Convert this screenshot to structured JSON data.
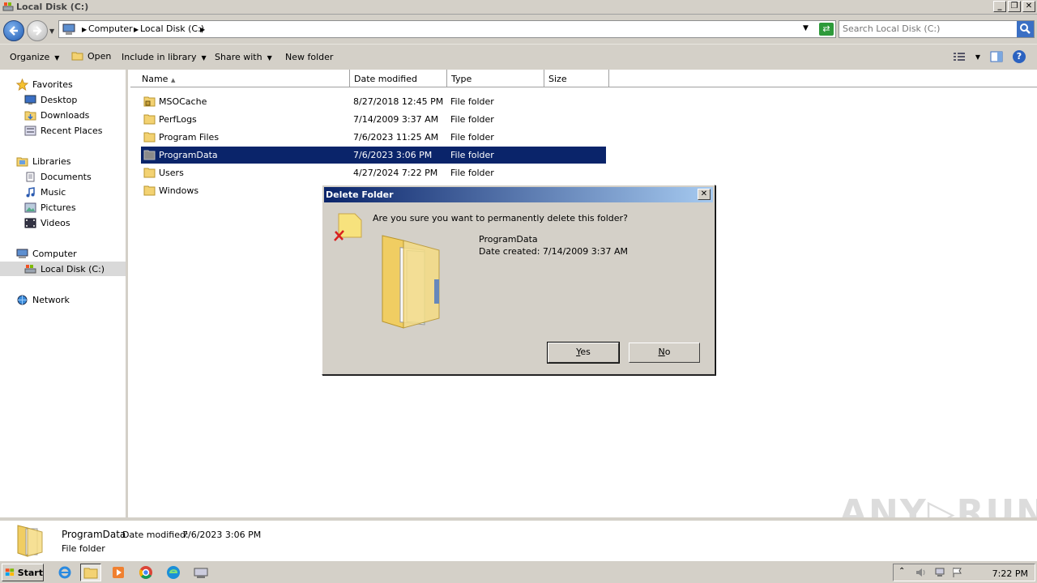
{
  "window": {
    "title": "Local Disk (C:)",
    "minimize": "_",
    "restore": "❐",
    "close": "✕"
  },
  "address": {
    "crumbs": [
      "Computer",
      "Local Disk (C:)"
    ],
    "search_placeholder": "Search Local Disk (C:)"
  },
  "toolbar": {
    "organize": "Organize",
    "open": "Open",
    "include_in_library": "Include in library",
    "share_with": "Share with",
    "new_folder": "New folder"
  },
  "nav": {
    "favorites": "Favorites",
    "desktop": "Desktop",
    "downloads": "Downloads",
    "recent_places": "Recent Places",
    "libraries": "Libraries",
    "documents": "Documents",
    "music": "Music",
    "pictures": "Pictures",
    "videos": "Videos",
    "computer": "Computer",
    "local_disk": "Local Disk (C:)",
    "network": "Network"
  },
  "columns": {
    "name": "Name",
    "date_modified": "Date modified",
    "type": "Type",
    "size": "Size"
  },
  "files": [
    {
      "name": "MSOCache",
      "date": "8/27/2018 12:45 PM",
      "type": "File folder"
    },
    {
      "name": "PerfLogs",
      "date": "7/14/2009 3:37 AM",
      "type": "File folder"
    },
    {
      "name": "Program Files",
      "date": "7/6/2023 11:25 AM",
      "type": "File folder"
    },
    {
      "name": "ProgramData",
      "date": "7/6/2023 3:06 PM",
      "type": "File folder"
    },
    {
      "name": "Users",
      "date": "4/27/2024 7:22 PM",
      "type": "File folder"
    },
    {
      "name": "Windows",
      "date": "",
      "type": ""
    }
  ],
  "dialog": {
    "title": "Delete Folder",
    "question": "Are you sure you want to permanently delete this folder?",
    "item_name": "ProgramData",
    "item_date": "Date created: 7/14/2009 3:37 AM",
    "yes_prefix": "Y",
    "yes_rest": "es",
    "no_prefix": "N",
    "no_rest": "o"
  },
  "details": {
    "name": "ProgramData",
    "modified_label": "Date modified:",
    "modified_value": "7/6/2023 3:06 PM",
    "type": "File folder"
  },
  "watermark": "ANY▷RUN",
  "taskbar": {
    "start": "Start",
    "clock": "7:22 PM"
  },
  "colors": {
    "selection": "#0a246a",
    "chrome": "#d4d0c8",
    "folder": "#f3d272"
  }
}
